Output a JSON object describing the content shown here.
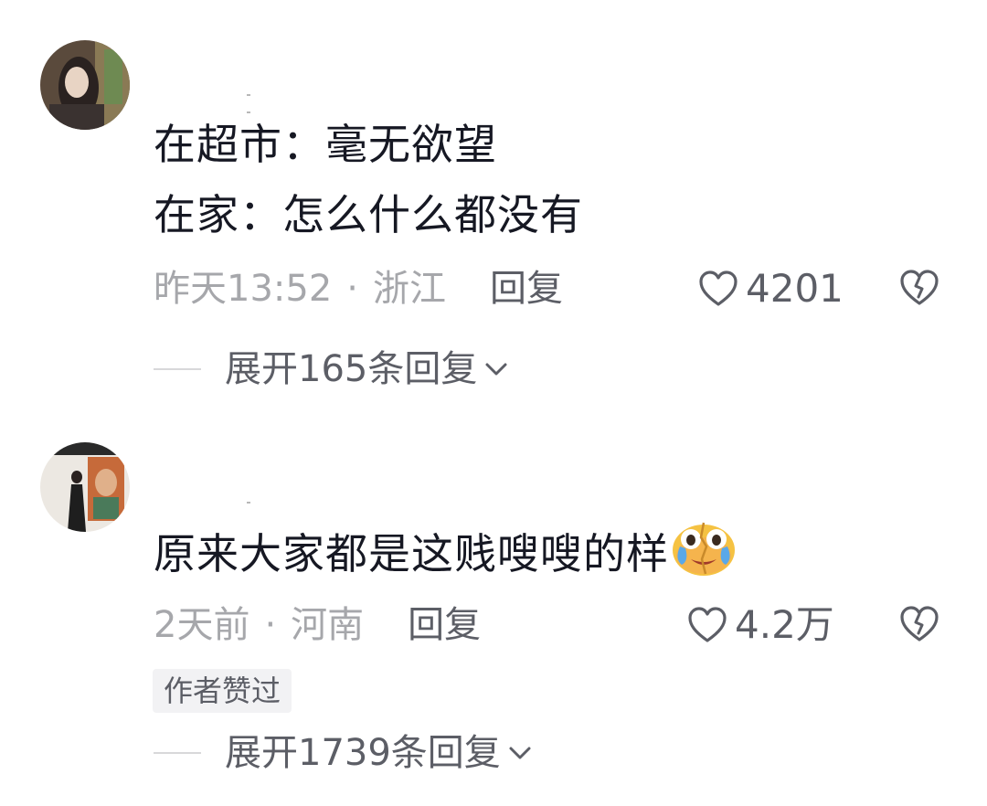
{
  "comments": [
    {
      "text_lines": [
        "在超市：毫无欲望",
        "在家：怎么什么都没有"
      ],
      "time": "昨天13:52",
      "separator": "·",
      "location": "浙江",
      "reply_label": "回复",
      "likes": "4201",
      "expand_label": "展开165条回复"
    },
    {
      "text_lines": [
        "原来大家都是这贱嗖嗖的样"
      ],
      "emoji": "crying-laughing-emoji",
      "time": "2天前",
      "separator": "·",
      "location": "河南",
      "reply_label": "回复",
      "likes": "4.2万",
      "badge": "作者赞过",
      "expand_label": "展开1739条回复"
    }
  ],
  "icons": {
    "like": "heart-outline-icon",
    "dislike": "broken-heart-icon",
    "expand": "chevron-down-icon"
  },
  "colors": {
    "text_primary": "#161823",
    "text_secondary": "#a6a7ab",
    "action": "#5c5e66",
    "badge_bg": "#f2f2f4"
  }
}
